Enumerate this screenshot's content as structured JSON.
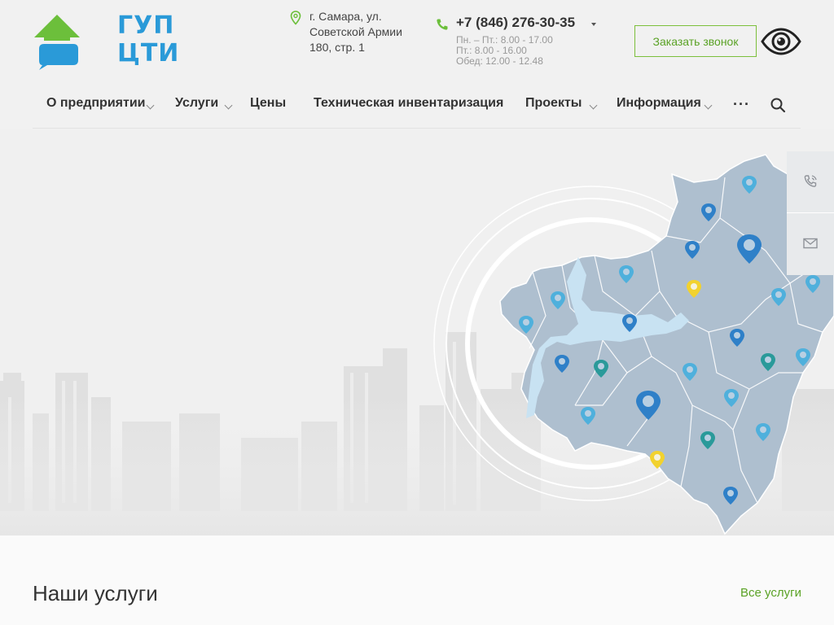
{
  "header": {
    "logo": {
      "line1": "ГУП",
      "line2": "ЦТИ",
      "icon": "house-logo-icon"
    },
    "address": {
      "icon": "map-pin-icon",
      "text": "г. Самара, ул. Советской Армии 180, стр. 1"
    },
    "phone": {
      "icon": "phone-icon",
      "number": "+7 (846) 276-30-35",
      "hours": [
        "Пн. – Пт.: 8.00 - 17.00",
        "Пт.: 8.00 - 16.00",
        "Обед: 12.00 - 12.48"
      ]
    },
    "callback_label": "Заказать звонок",
    "accessibility_icon": "eye-icon"
  },
  "nav": {
    "items": [
      {
        "label": "О предприятии",
        "dropdown": true
      },
      {
        "label": "Услуги",
        "dropdown": true
      },
      {
        "label": "Цены",
        "dropdown": false
      },
      {
        "label": "Техническая инвентаризация",
        "dropdown": false
      },
      {
        "label": "Проекты",
        "dropdown": true
      },
      {
        "label": "Информация",
        "dropdown": true
      }
    ],
    "more_label": "···",
    "search_icon": "search-icon"
  },
  "hero": {
    "map_icon": "region-map",
    "pin_colors": {
      "blue": "#2f80c8",
      "lightblue": "#4fb0dc",
      "teal": "#2a9a9a",
      "yellow": "#f2d22e"
    }
  },
  "side_panel": {
    "icons": [
      "phone-call-icon",
      "mail-icon"
    ]
  },
  "services": {
    "title": "Наши услуги",
    "all_link": "Все услуги"
  },
  "colors": {
    "brand_blue": "#2a9ad8",
    "brand_green": "#6cbf3b",
    "link_green": "#5aa225"
  }
}
